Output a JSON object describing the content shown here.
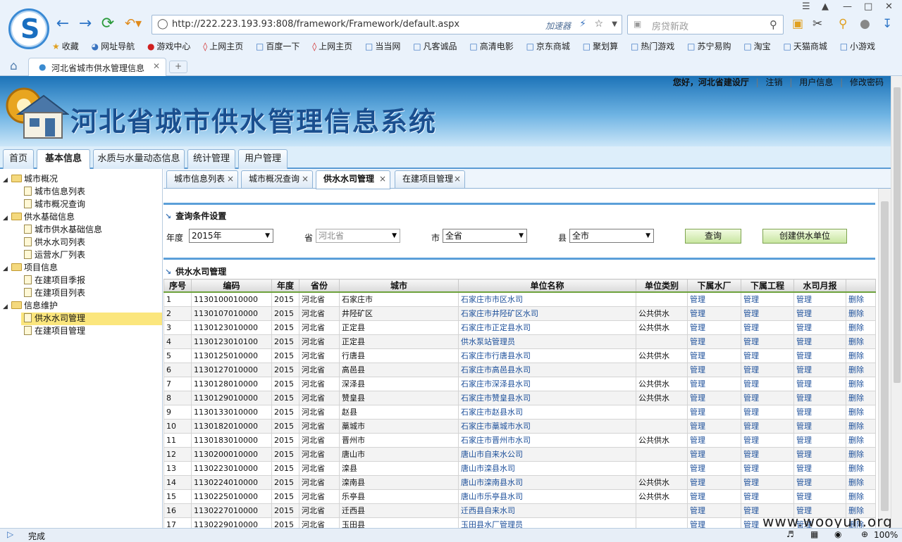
{
  "browser": {
    "url": "http://222.223.193.93:808/framework/Framework/default.aspx",
    "accelerator": "加速器",
    "search_placeholder": "房贷新政",
    "tab_title": "河北省城市供水管理信息",
    "status": "完成",
    "zoom": "100%",
    "bookmarks": [
      "收藏",
      "网址导航",
      "游戏中心",
      "上网主页",
      "百度一下",
      "上网主页",
      "当当网",
      "凡客诚品",
      "高清电影",
      "京东商城",
      "聚划算",
      "热门游戏",
      "苏宁易购",
      "淘宝",
      "天猫商城",
      "小游戏"
    ]
  },
  "header": {
    "title": "河北省城市供水管理信息系统",
    "greeting": "您好，河北省建设厅",
    "logout": "注销",
    "user_info": "用户信息",
    "change_password": "修改密码"
  },
  "menu": [
    "首页",
    "基本信息",
    "水质与水量动态信息",
    "统计管理",
    "用户管理"
  ],
  "tree": [
    {
      "label": "城市概况",
      "type": "folder"
    },
    {
      "label": "城市信息列表",
      "type": "leaf"
    },
    {
      "label": "城市概况查询",
      "type": "leaf"
    },
    {
      "label": "供水基础信息",
      "type": "folder"
    },
    {
      "label": "城市供水基础信息",
      "type": "leaf"
    },
    {
      "label": "供水水司列表",
      "type": "leaf"
    },
    {
      "label": "运营水厂列表",
      "type": "leaf"
    },
    {
      "label": "项目信息",
      "type": "folder"
    },
    {
      "label": "在建项目季报",
      "type": "leaf"
    },
    {
      "label": "在建项目列表",
      "type": "leaf"
    },
    {
      "label": "信息维护",
      "type": "folder"
    },
    {
      "label": "供水水司管理",
      "type": "leaf",
      "selected": true
    },
    {
      "label": "在建项目管理",
      "type": "leaf"
    }
  ],
  "content_tabs": [
    "城市信息列表",
    "城市概况查询",
    "供水水司管理",
    "在建项目管理"
  ],
  "query": {
    "section_title": "查询条件设置",
    "year_label": "年度",
    "year_value": "2015年",
    "province_label": "省",
    "province_value": "河北省",
    "city_label": "市",
    "city_value": "全省",
    "county_label": "县",
    "county_value": "全市",
    "query_button": "查询",
    "create_button": "创建供水单位"
  },
  "table": {
    "section_title": "供水水司管理",
    "headers": [
      "序号",
      "编码",
      "年度",
      "省份",
      "城市",
      "单位名称",
      "单位类别",
      "下属水厂",
      "下属工程",
      "水司月报",
      ""
    ],
    "manage": "管理",
    "delete": "删除",
    "rows": [
      [
        "1",
        "1130100010000",
        "2015",
        "河北省",
        "石家庄市",
        "石家庄市市区水司",
        ""
      ],
      [
        "2",
        "1130107010000",
        "2015",
        "河北省",
        "井陉矿区",
        "石家庄市井陉矿区水司",
        "公共供水"
      ],
      [
        "3",
        "1130123010000",
        "2015",
        "河北省",
        "正定县",
        "石家庄市正定县水司",
        "公共供水"
      ],
      [
        "4",
        "1130123010100",
        "2015",
        "河北省",
        "正定县",
        "供水泵站管理员",
        ""
      ],
      [
        "5",
        "1130125010000",
        "2015",
        "河北省",
        "行唐县",
        "石家庄市行唐县水司",
        "公共供水"
      ],
      [
        "6",
        "1130127010000",
        "2015",
        "河北省",
        "高邑县",
        "石家庄市高邑县水司",
        ""
      ],
      [
        "7",
        "1130128010000",
        "2015",
        "河北省",
        "深泽县",
        "石家庄市深泽县水司",
        "公共供水"
      ],
      [
        "8",
        "1130129010000",
        "2015",
        "河北省",
        "赞皇县",
        "石家庄市赞皇县水司",
        "公共供水"
      ],
      [
        "9",
        "1130133010000",
        "2015",
        "河北省",
        "赵县",
        "石家庄市赵县水司",
        ""
      ],
      [
        "10",
        "1130182010000",
        "2015",
        "河北省",
        "藁城市",
        "石家庄市藁城市水司",
        ""
      ],
      [
        "11",
        "1130183010000",
        "2015",
        "河北省",
        "晋州市",
        "石家庄市晋州市水司",
        "公共供水"
      ],
      [
        "12",
        "1130200010000",
        "2015",
        "河北省",
        "唐山市",
        "唐山市自来水公司",
        ""
      ],
      [
        "13",
        "1130223010000",
        "2015",
        "河北省",
        "滦县",
        "唐山市滦县水司",
        ""
      ],
      [
        "14",
        "1130224010000",
        "2015",
        "河北省",
        "滦南县",
        "唐山市滦南县水司",
        "公共供水"
      ],
      [
        "15",
        "1130225010000",
        "2015",
        "河北省",
        "乐亭县",
        "唐山市乐亭县水司",
        "公共供水"
      ],
      [
        "16",
        "1130227010000",
        "2015",
        "河北省",
        "迁西县",
        "迁西县自来水司",
        ""
      ],
      [
        "17",
        "1130229010000",
        "2015",
        "河北省",
        "玉田县",
        "玉田县水厂管理员",
        ""
      ]
    ]
  },
  "watermark": "www.wooyun.org"
}
